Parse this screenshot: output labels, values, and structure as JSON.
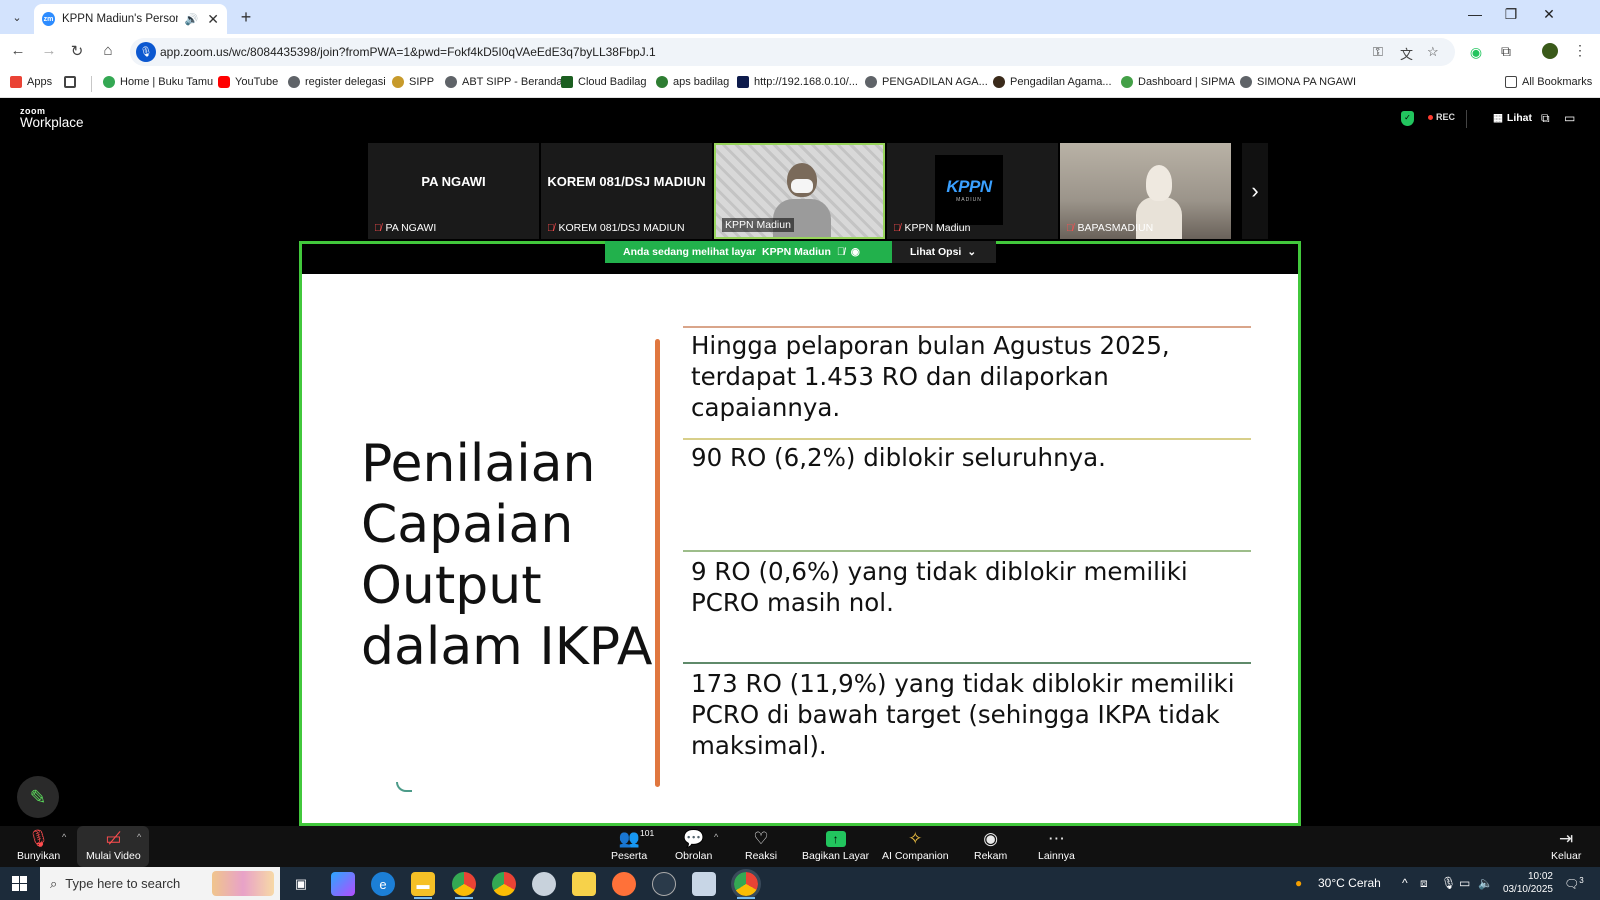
{
  "browser": {
    "tab_title": "KPPN Madiun's Personal Meeting Room",
    "url": "app.zoom.us/wc/8084435398/join?fromPWA=1&pwd=Fokf4kD5I0qVAeEdE3q7byLL38FbpJ.1",
    "bookmarks": [
      {
        "label": "Apps",
        "color": "#ea4335"
      },
      {
        "label": "Home | Buku Tamu",
        "color": "#34a853"
      },
      {
        "label": "YouTube",
        "color": "#ff0000"
      },
      {
        "label": "register delegasi",
        "color": "#5f6368"
      },
      {
        "label": "SIPP",
        "color": "#c79a2b"
      },
      {
        "label": "ABT SIPP - Beranda",
        "color": "#5f6368"
      },
      {
        "label": "Cloud Badilag",
        "color": "#1b5e20"
      },
      {
        "label": "aps badilag",
        "color": "#2e7d32"
      },
      {
        "label": "http://192.168.0.10/...",
        "color": "#0d1b4c"
      },
      {
        "label": "PENGADILAN AGA...",
        "color": "#5f6368"
      },
      {
        "label": "Pengadilan Agama...",
        "color": "#3a2a1a"
      },
      {
        "label": "Dashboard | SIPMA",
        "color": "#43a047"
      },
      {
        "label": "SIMONA PA NGAWI",
        "color": "#5f6368"
      }
    ],
    "all_bookmarks": "All Bookmarks"
  },
  "zoom": {
    "logo_top": "zoom",
    "logo_bottom": "Workplace",
    "rec": "REC",
    "view_label": "Lihat",
    "participants": [
      {
        "big": "PA NGAWI",
        "name": "PA NGAWI"
      },
      {
        "big": "KOREM 081/DSJ MADIUN",
        "name": "KOREM 081/DSJ MADIUN"
      },
      {
        "big": "",
        "name": "KPPN Madiun"
      },
      {
        "big": "",
        "name": "KPPN Madiun",
        "logo": "KPPN",
        "logo_sub": "MADIUN"
      },
      {
        "big": "",
        "name": "BAPASMADIUN"
      }
    ],
    "share_banner": "Anda sedang melihat layar",
    "share_owner": "KPPN Madiun",
    "view_options": "Lihat Opsi",
    "toolbar": {
      "unmute": "Bunyikan",
      "video": "Mulai Video",
      "participants": "Peserta",
      "participants_count": "101",
      "chat": "Obrolan",
      "reactions": "Reaksi",
      "share": "Bagikan Layar",
      "ai": "AI Companion",
      "record": "Rekam",
      "more": "Lainnya",
      "leave": "Keluar"
    }
  },
  "slide": {
    "title": "Penilaian Capaian Output dalam IKPA",
    "points": [
      "Hingga pelaporan bulan Agustus 2025, terdapat 1.453 RO dan dilaporkan capaiannya.",
      "90 RO (6,2%) diblokir seluruhnya.",
      "9 RO (0,6%) yang tidak diblokir memiliki PCRO masih nol.",
      "173 RO (11,9%) yang tidak diblokir memiliki PCRO di bawah target (sehingga IKPA tidak maksimal)."
    ],
    "rule_colors": [
      "#d9a58a",
      "#d8cf8a",
      "#9dbd8a",
      "#5f8a6a"
    ],
    "accent_color": "#e0773f"
  },
  "taskbar": {
    "search_placeholder": "Type here to search",
    "weather": "30°C  Cerah",
    "time": "10:02",
    "date": "03/10/2025",
    "notifications": "3"
  }
}
